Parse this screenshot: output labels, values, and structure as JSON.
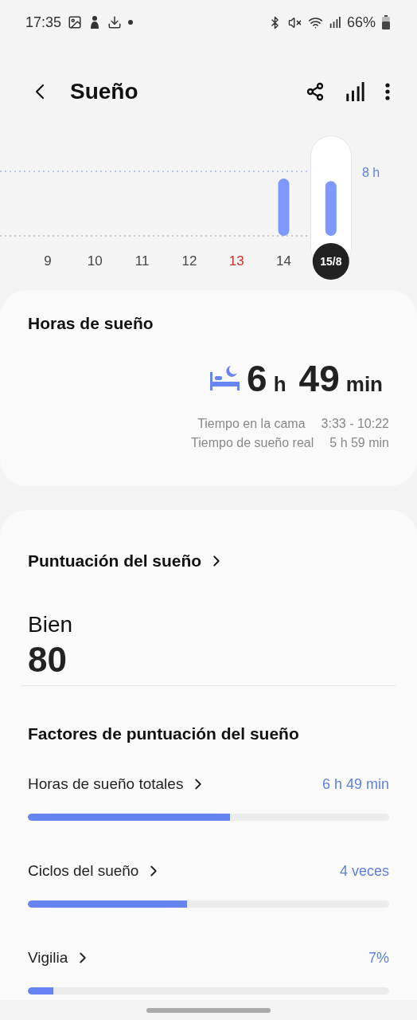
{
  "status_bar": {
    "time": "17:35",
    "battery": "66%"
  },
  "app_bar": {
    "title": "Sueño"
  },
  "week_chart": {
    "chart_data": {
      "type": "bar",
      "categories": [
        "9",
        "10",
        "11",
        "12",
        "13",
        "14",
        "15/8"
      ],
      "values": [
        null,
        null,
        null,
        null,
        null,
        7.1,
        6.8
      ],
      "yticks": [
        {
          "value": 8,
          "label": "8 h"
        }
      ],
      "ylim": [
        0,
        8
      ]
    },
    "days": [
      {
        "selected": false,
        "holiday": false
      },
      {
        "selected": false,
        "holiday": false
      },
      {
        "selected": false,
        "holiday": false
      },
      {
        "selected": false,
        "holiday": false
      },
      {
        "selected": false,
        "holiday": true
      },
      {
        "selected": false,
        "holiday": false
      },
      {
        "selected": true,
        "holiday": false
      }
    ]
  },
  "sleep_hours": {
    "title": "Horas de sueño",
    "hours": "6",
    "hours_unit": "h",
    "minutes": "49",
    "minutes_unit": "min",
    "details": [
      {
        "label": "Tiempo en la cama",
        "value": "3:33 - 10:22"
      },
      {
        "label": "Tiempo de sueño real",
        "value": "5 h 59 min"
      }
    ]
  },
  "score": {
    "title": "Puntuación del sueño",
    "rating": "Bien",
    "value": "80",
    "factors_title": "Factores de puntuación del sueño",
    "factors": [
      {
        "label": "Horas de sueño totales",
        "value": "6 h 49 min",
        "level": 0.56
      },
      {
        "label": "Ciclos del sueño",
        "value": "4 veces",
        "level": 0.44
      },
      {
        "label": "Vigilia",
        "value": "7%",
        "level": 0.07
      }
    ]
  }
}
